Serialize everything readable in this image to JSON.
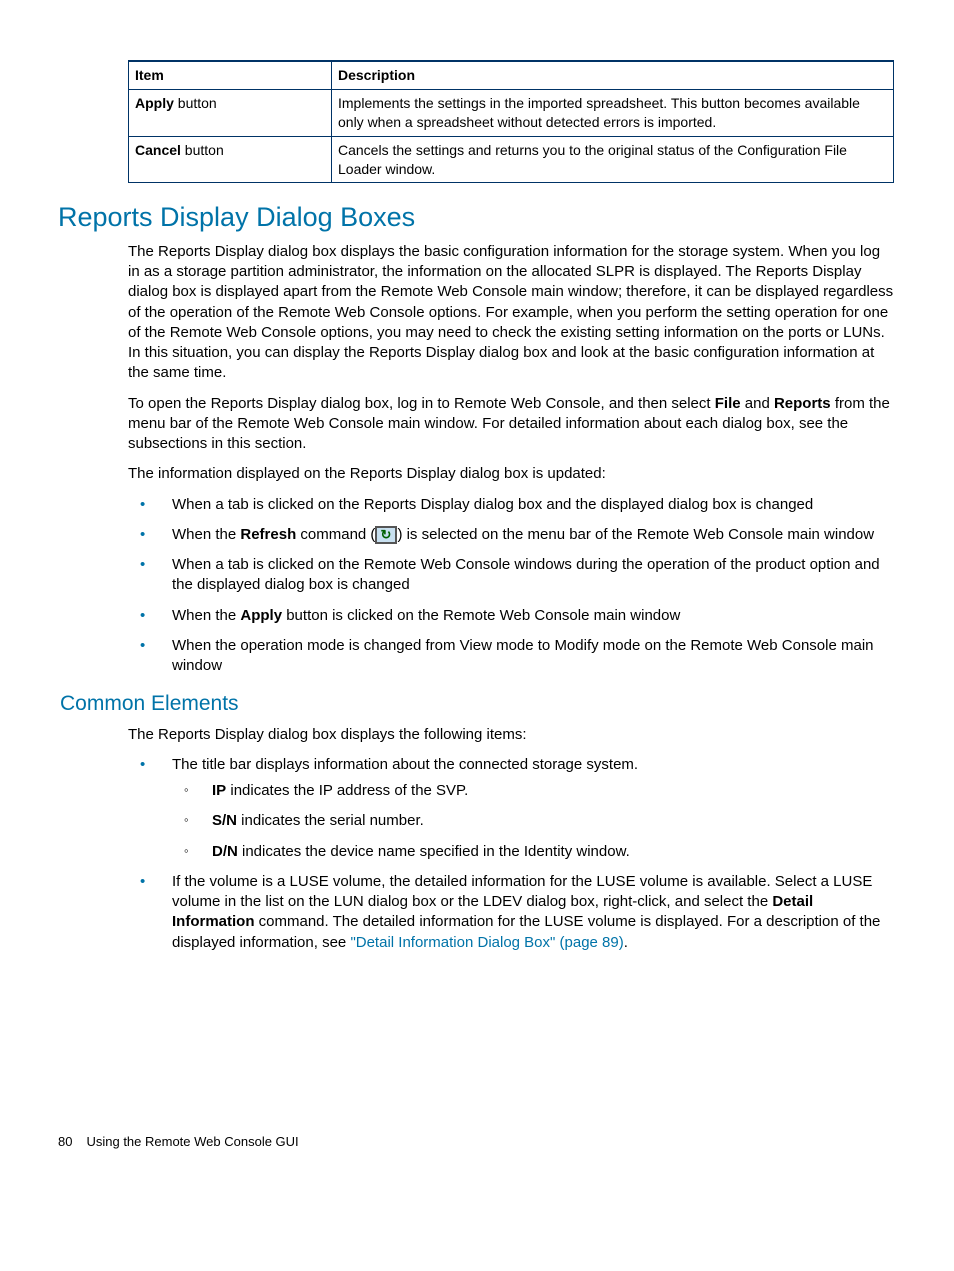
{
  "table": {
    "headers": [
      "Item",
      "Description"
    ],
    "rows": [
      {
        "item_bold": "Apply",
        "item_rest": " button",
        "desc": "Implements the settings in the imported spreadsheet. This button becomes available only when a spreadsheet without detected errors is imported."
      },
      {
        "item_bold": "Cancel",
        "item_rest": " button",
        "desc": "Cancels the settings and returns you to the original status of the Configuration File Loader window."
      }
    ]
  },
  "h1": "Reports Display Dialog Boxes",
  "p1": "The Reports Display dialog box displays the basic configuration information for the storage system. When you log in as a storage partition administrator, the information on the allocated SLPR is displayed. The Reports Display dialog box is displayed apart from the Remote Web Console main window; therefore, it can be displayed regardless of the operation of the Remote Web Console options. For example, when you perform the setting operation for one of the Remote Web Console options, you may need to check the existing setting information on the ports or LUNs. In this situation, you can display the Reports Display dialog box and look at the basic configuration information at the same time.",
  "p2_pre": "To open the Reports Display dialog box, log in to Remote Web Console, and then select ",
  "p2_b1": "File",
  "p2_mid": " and ",
  "p2_b2": "Reports",
  "p2_post": " from the menu bar of the Remote Web Console main window. For detailed information about each dialog box, see the subsections in this section.",
  "p3": "The information displayed on the Reports Display dialog box is updated:",
  "list1": {
    "i1": "When a tab is clicked on the Reports Display dialog box and the displayed dialog box is changed",
    "i2_pre": "When the ",
    "i2_b": "Refresh",
    "i2_mid": " command (",
    "i2_post": ") is selected on the menu bar of the Remote Web Console main window",
    "i3": "When a tab is clicked on the Remote Web Console windows during the operation of the product option and the displayed dialog box is changed",
    "i4_pre": "When the ",
    "i4_b": "Apply",
    "i4_post": " button is clicked on the Remote Web Console main window",
    "i5": "When the operation mode is changed from View mode to Modify mode on the Remote Web Console main window"
  },
  "h2": "Common Elements",
  "p4": "The Reports Display dialog box displays the following items:",
  "list2": {
    "i1": "The title bar displays information about the connected storage system.",
    "sub": {
      "s1_b": "IP",
      "s1_t": " indicates the IP address of the SVP.",
      "s2_b": "S/N",
      "s2_t": " indicates the serial number.",
      "s3_b": "D/N",
      "s3_t": " indicates the device name specified in the Identity window."
    },
    "i2_pre": "If the volume is a LUSE volume, the detailed information for the LUSE volume is available. Select a LUSE volume in the list on the LUN dialog box or the LDEV dialog box, right-click, and select the ",
    "i2_b": "Detail Information",
    "i2_mid": " command. The detailed information for the LUSE volume is displayed. For a description of the displayed information, see ",
    "i2_link": "\"Detail Information Dialog Box\" (page 89)",
    "i2_post": "."
  },
  "footer": {
    "page": "80",
    "title": "Using the Remote Web Console GUI"
  }
}
